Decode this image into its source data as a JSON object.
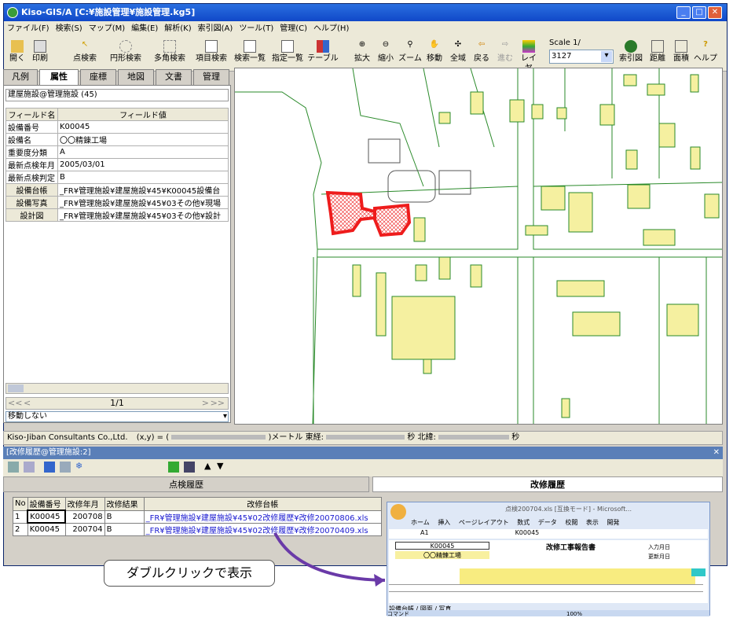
{
  "window": {
    "title": "Kiso-GIS/A [C:¥施設管理¥施設管理.kg5]"
  },
  "menu": [
    "ファイル(F)",
    "検索(S)",
    "マップ(M)",
    "編集(E)",
    "解析(K)",
    "索引図(A)",
    "ツール(T)",
    "管理(C)",
    "ヘルプ(H)"
  ],
  "toolbar": [
    {
      "label": "開く"
    },
    {
      "label": "印刷"
    },
    {
      "label": "点検索"
    },
    {
      "label": "円形検索"
    },
    {
      "label": "多角検索"
    },
    {
      "label": "項目検索"
    },
    {
      "label": "検索一覧"
    },
    {
      "label": "指定一覧"
    },
    {
      "label": "テーブル"
    },
    {
      "label": "拡大"
    },
    {
      "label": "縮小"
    },
    {
      "label": "ズーム"
    },
    {
      "label": "移動"
    },
    {
      "label": "全域"
    },
    {
      "label": "戻る"
    },
    {
      "label": "進む"
    },
    {
      "label": "レイヤ"
    },
    {
      "label": "索引図"
    },
    {
      "label": "距離"
    },
    {
      "label": "面積"
    },
    {
      "label": "ヘルプ"
    }
  ],
  "scale": {
    "label": "Scale 1/",
    "value": "3127"
  },
  "tabs": [
    "凡例",
    "属性",
    "座標",
    "地図",
    "文書",
    "管理"
  ],
  "layer_title": "建屋施設@管理施設 (45)",
  "attr_headers": [
    "フィールド名",
    "フィールド値"
  ],
  "attributes": [
    {
      "name": "設備番号",
      "value": "K00045"
    },
    {
      "name": "設備名",
      "value": "〇〇精錬工場"
    },
    {
      "name": "重要度分類",
      "value": "A"
    },
    {
      "name": "最新点検年月",
      "value": "2005/03/01"
    },
    {
      "name": "最新点検判定",
      "value": "B"
    },
    {
      "name": "設備台帳",
      "value": "_FR¥管理施設¥建屋施設¥45¥K00045設備台"
    },
    {
      "name": "設備写真",
      "value": "_FR¥管理施設¥建屋施設¥45¥03その他¥現場"
    },
    {
      "name": "設計図",
      "value": "_FR¥管理施設¥建屋施設¥45¥03その他¥設計"
    }
  ],
  "pager": "1/1",
  "move_select": "移動しない",
  "status": {
    "company": "Kiso-Jiban Consultants Co.,Ltd.",
    "xy": "(x,y) = (",
    "meter": ")メートル 東経:",
    "sec1": "秒 北緯:",
    "sec2": "秒"
  },
  "sub_title": "[改修履歴@管理施設:2]",
  "sub_tabs": [
    "点検履歴",
    "改修履歴"
  ],
  "repair_headers": [
    "No",
    "設備番号",
    "改修年月",
    "改修結果",
    "改修台帳"
  ],
  "repairs": [
    {
      "no": "1",
      "id": "K00045",
      "ym": "200708",
      "res": "B",
      "file": "_FR¥管理施設¥建屋施設¥45¥02改修履歴¥改修20070806.xls"
    },
    {
      "no": "2",
      "id": "K00045",
      "ym": "200704",
      "res": "B",
      "file": "_FR¥管理施設¥建屋施設¥45¥02改修履歴¥改修20070409.xls"
    }
  ],
  "excel": {
    "title": "点検200704.xls [互換モード] - Microsoft...",
    "ribbon": [
      "ホーム",
      "挿入",
      "ページレイアウト",
      "数式",
      "データ",
      "校閲",
      "表示",
      "開発"
    ],
    "cell": "A1",
    "fx": "K00045",
    "id": "K00045",
    "name": "〇〇精錬工場",
    "heading": "改修工事報告書",
    "lab1": "入力月日",
    "lab2": "更新月日",
    "sheets": "設備台帳 / 図面 / 写真",
    "cmd": "コマンド",
    "zoom": "100%"
  },
  "callout": "ダブルクリックで表示",
  "colors": {
    "building": "#f5f0a0",
    "outline": "#2a8a2a",
    "highlight": "#ee1c1c"
  }
}
